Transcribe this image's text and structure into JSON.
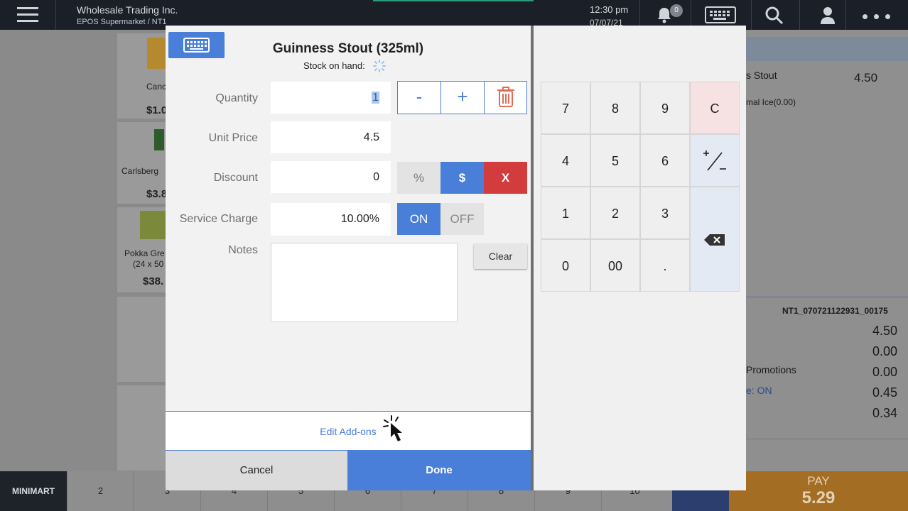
{
  "topbar": {
    "company": "Wholesale Trading Inc.",
    "store": "EPOS Supermarket / NT1",
    "time": "12:30 pm",
    "date": "07/07/21",
    "bell_count": "0"
  },
  "background": {
    "products": [
      {
        "name": "Canc",
        "price": "$1.0"
      },
      {
        "name": "Carlsberg",
        "price": "$3.8"
      },
      {
        "name": "Pokka Gre",
        "name2": "(24 x 50",
        "price": "$38."
      }
    ],
    "order": {
      "item_name": "s Stout",
      "item_price": "4.50",
      "item_note": "mal Ice(0.00)",
      "order_id": "NT1_070721122931_00175",
      "summary_values": [
        "4.50",
        "0.00",
        "0.00",
        "0.45",
        "0.34"
      ],
      "promotions_label": "Promotions",
      "service_label": "e: ON"
    },
    "bottom_tabs": [
      "MINIMART",
      "2",
      "3",
      "4",
      "5",
      "6",
      "7",
      "8",
      "9",
      "10"
    ],
    "pay_label": "PAY",
    "pay_amount": "5.29"
  },
  "modal": {
    "title": "Guinness Stout (325ml)",
    "stock_label": "Stock on hand:",
    "quantity_label": "Quantity",
    "quantity_value": "1",
    "minus_label": "-",
    "plus_label": "+",
    "unit_price_label": "Unit Price",
    "unit_price_value": "4.5",
    "discount_label": "Discount",
    "discount_value": "0",
    "percent_label": "%",
    "dollar_label": "$",
    "remove_label": "X",
    "service_label": "Service Charge",
    "service_value": "10.00%",
    "on_label": "ON",
    "off_label": "OFF",
    "notes_label": "Notes",
    "notes_value": "",
    "clear_label": "Clear",
    "addons_label": "Edit Add-ons",
    "cancel_label": "Cancel",
    "done_label": "Done"
  },
  "keypad": {
    "keys": [
      "7",
      "8",
      "9",
      "C",
      "4",
      "5",
      "6",
      "1",
      "2",
      "3",
      "0",
      "00",
      "."
    ],
    "plus_minus": "+/-"
  },
  "colors": {
    "accent": "#4a7fd9",
    "danger": "#d33c3c",
    "pay": "#a36d24",
    "topbar": "#1b1f27"
  }
}
